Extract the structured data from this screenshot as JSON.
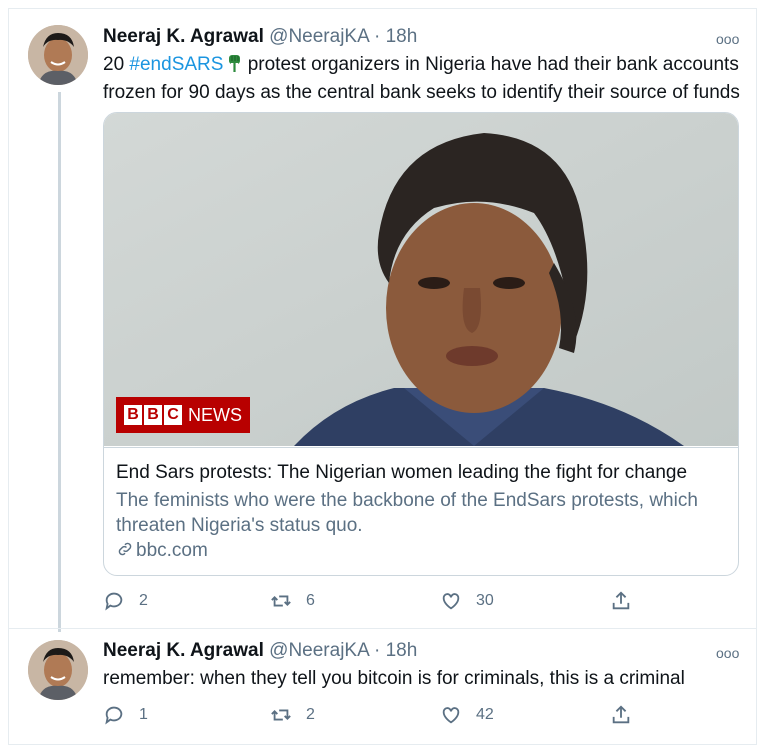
{
  "tweets": [
    {
      "name": "Neeraj K. Agrawal",
      "handle": "@NeerajKA",
      "separator": "·",
      "time": "18h",
      "more": "ooo",
      "text_prefix": "20 ",
      "hashtag": "#endSARS",
      "text_line1_rest": " protest organizers in Nigeria have had their bank accounts",
      "text_line2": "frozen for 90 days as the central bank seeks to identify their source of funds",
      "card": {
        "title": "End Sars protests: The Nigerian women leading the fight for change",
        "description": "The feminists who were the backbone of the EndSars protests, which threaten Nigeria's status quo.",
        "domain": "bbc.com",
        "badge_letters": [
          "B",
          "B",
          "C"
        ],
        "badge_word": "NEWS"
      },
      "actions": {
        "replies": "2",
        "retweets": "6",
        "likes": "30"
      }
    },
    {
      "name": "Neeraj K. Agrawal",
      "handle": "@NeerajKA",
      "separator": "·",
      "time": "18h",
      "more": "ooo",
      "text": "remember: when they tell you bitcoin is for criminals, this is a criminal",
      "actions": {
        "replies": "1",
        "retweets": "2",
        "likes": "42"
      }
    }
  ],
  "colors": {
    "accent": "#1b95e0",
    "secondary_text": "#5b7083",
    "border": "#ccd6dd",
    "bbc_red": "#b80000"
  },
  "icons": {
    "reply": "reply-icon",
    "retweet": "retweet-icon",
    "like": "heart-icon",
    "share": "share-icon",
    "link": "link-icon",
    "more": "more-icon",
    "emoji": "raised-fist-emoji"
  }
}
